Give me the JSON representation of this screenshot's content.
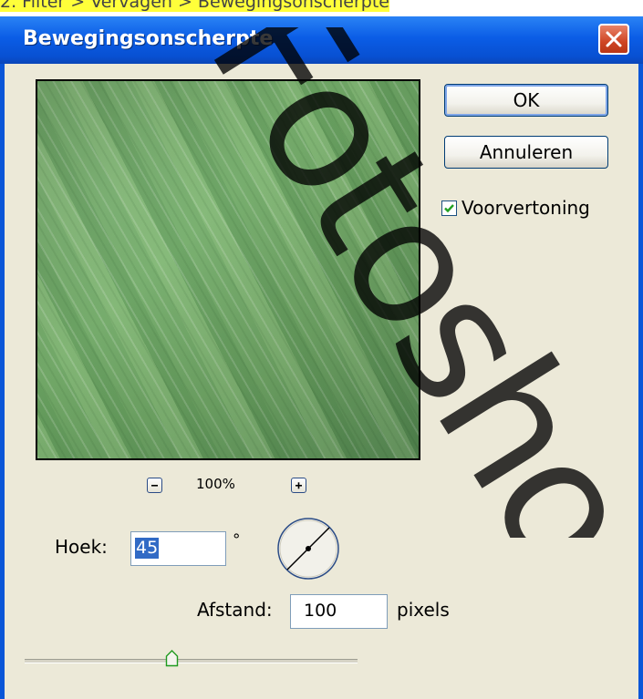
{
  "caption": {
    "text": "2. Filter > Vervagen > Bewegingsonscherpte",
    "highlight_color": "#ffff3a"
  },
  "dialog": {
    "title": "Bewegingsonscherpte",
    "close_icon": "close-x-icon"
  },
  "buttons": {
    "ok_label": "OK",
    "cancel_label": "Annuleren"
  },
  "preview_toggle": {
    "label": "Voorvertoning",
    "checked": true
  },
  "zoom": {
    "level": "100%",
    "zoom_out_icon": "minus-icon",
    "zoom_in_icon": "plus-icon"
  },
  "angle": {
    "label": "Hoek:",
    "value": "45",
    "unit": "°"
  },
  "distance": {
    "label": "Afstand:",
    "value": "100",
    "unit": "pixels",
    "slider_fraction": 0.44
  },
  "watermark": {
    "text": "Fotoshop"
  },
  "colors": {
    "titlebar": "#0b5de6",
    "dialog_bg": "#ece9d8",
    "preview_green": "#6ea464",
    "selection": "#316ac5"
  }
}
